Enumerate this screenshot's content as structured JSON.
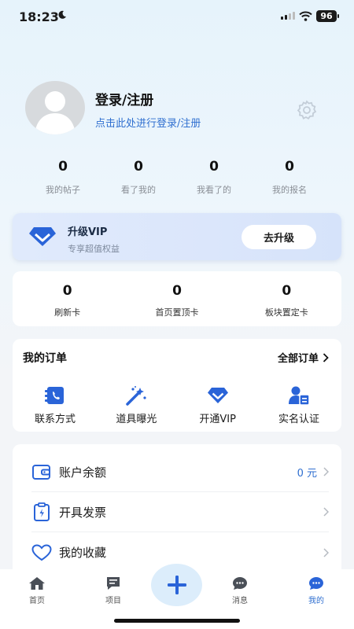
{
  "status": {
    "time": "18:23",
    "battery": "96"
  },
  "profile": {
    "title": "登录/注册",
    "subtitle": "点击此处进行登录/注册"
  },
  "stats": [
    {
      "value": "0",
      "label": "我的帖子"
    },
    {
      "value": "0",
      "label": "看了我的"
    },
    {
      "value": "0",
      "label": "我看了的"
    },
    {
      "value": "0",
      "label": "我的报名"
    }
  ],
  "vip": {
    "title": "升级VIP",
    "subtitle": "专享超值权益",
    "button": "去升级"
  },
  "cards": [
    {
      "value": "0",
      "label": "刷新卡"
    },
    {
      "value": "0",
      "label": "首页置顶卡"
    },
    {
      "value": "0",
      "label": "板块置定卡"
    }
  ],
  "orders": {
    "title": "我的订单",
    "all": "全部订单",
    "items": [
      {
        "label": "联系方式",
        "icon": "contact-card-icon"
      },
      {
        "label": "道具曝光",
        "icon": "magic-wand-icon"
      },
      {
        "label": "开通VIP",
        "icon": "vip-diamond-icon"
      },
      {
        "label": "实名认证",
        "icon": "id-verify-icon"
      }
    ]
  },
  "menu": [
    {
      "label": "账户余额",
      "value": "0 元",
      "icon": "wallet-icon"
    },
    {
      "label": "开具发票",
      "value": "",
      "icon": "invoice-icon"
    },
    {
      "label": "我的收藏",
      "value": "",
      "icon": "heart-icon"
    }
  ],
  "tabs": [
    {
      "label": "首页",
      "icon": "home-icon"
    },
    {
      "label": "项目",
      "icon": "project-icon"
    },
    {
      "label": "消息",
      "icon": "message-icon"
    },
    {
      "label": "我的",
      "icon": "profile-icon"
    }
  ],
  "colors": {
    "accent": "#2f6fd0",
    "vip_blue": "#2a64d8",
    "fab_bg": "#dcedfb"
  }
}
